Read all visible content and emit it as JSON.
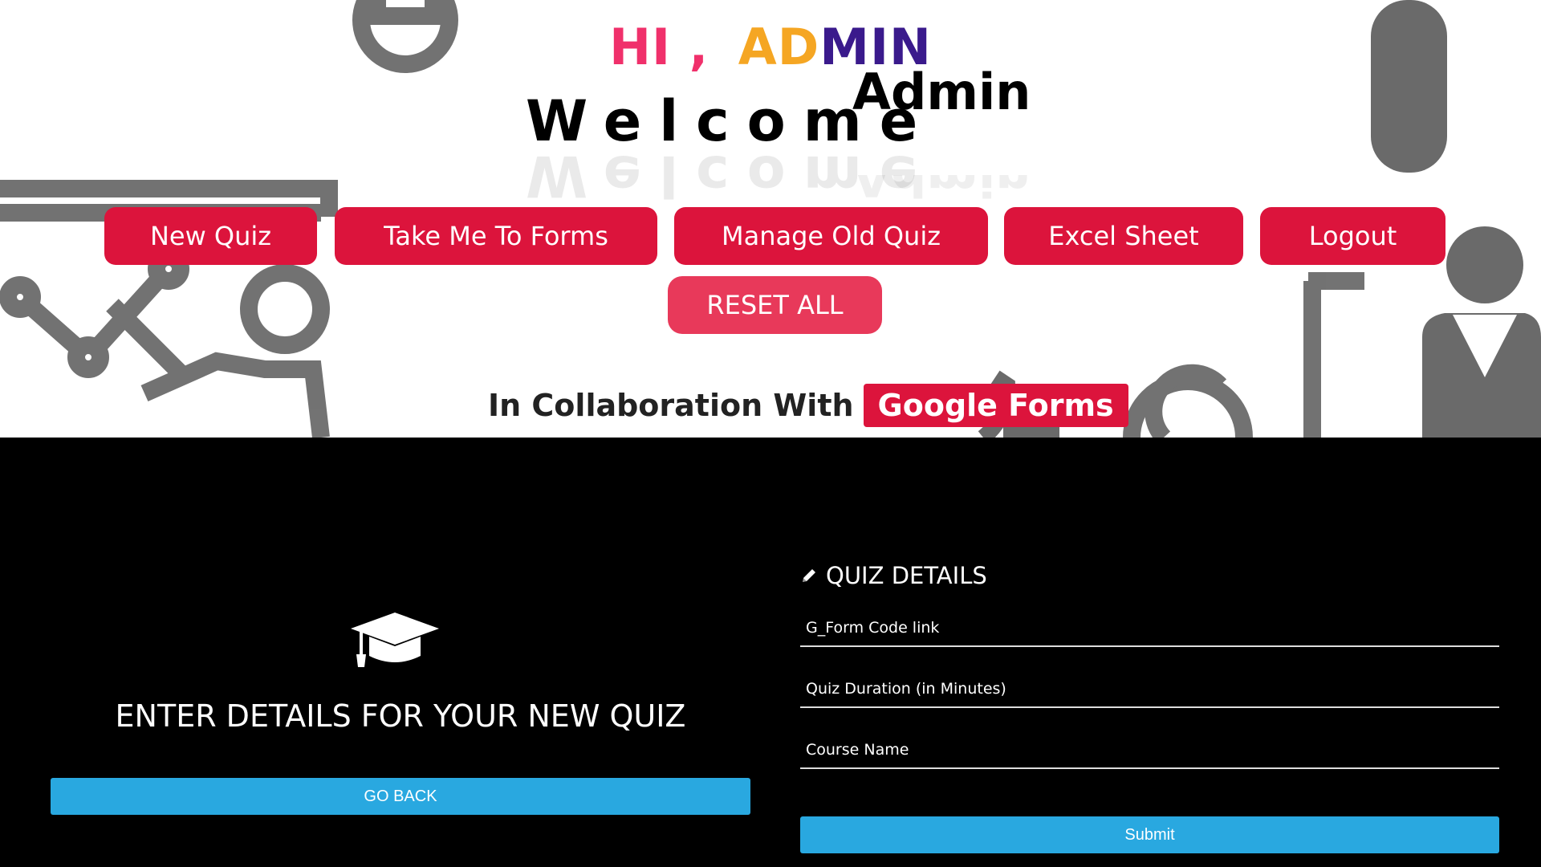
{
  "header": {
    "greeting_parts": [
      {
        "text": "HI ,",
        "color": "#f0306b"
      },
      {
        "text": "AD",
        "color": "#f5a623"
      },
      {
        "text": "MIN",
        "color": "#3a1a8c"
      }
    ],
    "welcome": "Welcome",
    "admin_name": "Admin"
  },
  "nav": {
    "new_quiz": "New Quiz",
    "forms": "Take Me To Forms",
    "manage": "Manage Old Quiz",
    "excel": "Excel Sheet",
    "logout": "Logout",
    "reset": "RESET ALL"
  },
  "collab": {
    "text": "In Collaboration With",
    "badge": "Google Forms"
  },
  "left_panel": {
    "icon": "graduation-cap-icon",
    "title": "ENTER DETAILS FOR YOUR NEW QUIZ",
    "go_back": "GO BACK"
  },
  "form": {
    "icon": "pencil-icon",
    "title": "QUIZ DETAILS",
    "fields": [
      {
        "placeholder": "G_Form Code link"
      },
      {
        "placeholder": "Quiz Duration (in Minutes)"
      },
      {
        "placeholder": "Course Name"
      }
    ],
    "submit": "Submit"
  },
  "colors": {
    "accent": "#dc143c",
    "reset": "#e8395a",
    "blue": "#29a8e0"
  }
}
